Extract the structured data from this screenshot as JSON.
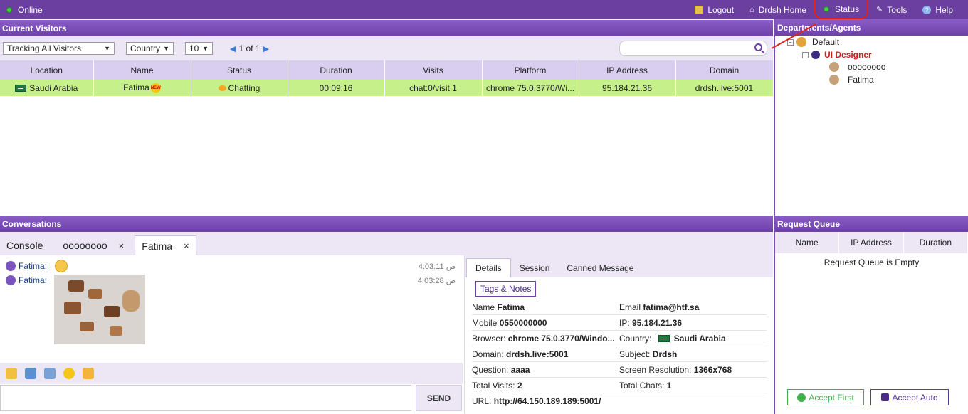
{
  "topbar": {
    "online_label": "Online",
    "nav": [
      {
        "label": "Logout",
        "icon": "logout-icon"
      },
      {
        "label": "Drdsh Home",
        "icon": "home-icon"
      },
      {
        "label": "Status",
        "icon": "status-dot-icon"
      },
      {
        "label": "Tools",
        "icon": "wrench-icon"
      },
      {
        "label": "Help",
        "icon": "help-icon"
      }
    ]
  },
  "visitors": {
    "header": "Current Visitors",
    "tracking_select": "Tracking All Visitors",
    "country_select": "Country",
    "per_page_select": "10",
    "pager_text": "1 of 1",
    "columns": [
      "Location",
      "Name",
      "Status",
      "Duration",
      "Visits",
      "Platform",
      "IP Address",
      "Domain"
    ],
    "rows": [
      {
        "location": "Saudi Arabia",
        "name": "Fatima",
        "new_badge": "NEW",
        "status": "Chatting",
        "duration": "00:09:16",
        "visits": "chat:0/visit:1",
        "platform": "chrome 75.0.3770/Wi...",
        "ip": "95.184.21.36",
        "domain": "drdsh.live:5001"
      }
    ]
  },
  "departments": {
    "header": "Departments/Agents",
    "default_label": "Default",
    "group_label": "UI Designer",
    "agents": [
      "oooooooo",
      "Fatima"
    ]
  },
  "conversations": {
    "header": "Conversations",
    "tabs": [
      {
        "label": "Console"
      },
      {
        "label": "oooooooo",
        "close": "×"
      },
      {
        "label": "Fatima",
        "close": "×"
      }
    ],
    "messages": [
      {
        "sender": "Fatima:",
        "time": "4:03:11 ص"
      },
      {
        "sender": "Fatima:",
        "time": "4:03:28 ص"
      }
    ],
    "send_label": "SEND"
  },
  "details": {
    "tabs": [
      "Details",
      "Session",
      "Canned Message"
    ],
    "tags_button": "Tags & Notes",
    "fields": [
      {
        "l1": "Name",
        "v1": "Fatima",
        "l2": "Email",
        "v2": "fatima@htf.sa"
      },
      {
        "l1": "Mobile",
        "v1": "0550000000",
        "l2": "IP:",
        "v2": "95.184.21.36"
      },
      {
        "l1": "Browser:",
        "v1": "chrome 75.0.3770/Windo...",
        "l2": "Country:",
        "v2": "Saudi Arabia"
      },
      {
        "l1": "Domain:",
        "v1": "drdsh.live:5001",
        "l2": "Subject:",
        "v2": "Drdsh"
      },
      {
        "l1": "Question:",
        "v1": "aaaa",
        "l2": "Screen Resolution:",
        "v2": "1366x768"
      },
      {
        "l1": "Total Visits:",
        "v1": "2",
        "l2": "Total Chats:",
        "v2": "1"
      },
      {
        "l1": "URL:",
        "v1": "http://64.150.189.189:5001/",
        "l2": "",
        "v2": ""
      }
    ]
  },
  "queue": {
    "header": "Request Queue",
    "columns": [
      "Name",
      "IP Address",
      "Duration"
    ],
    "empty_text": "Request Queue is Empty",
    "accept_first": "Accept First",
    "accept_auto": "Accept Auto"
  },
  "colors": {
    "brand": "#6a3fa0",
    "row_highlight": "#c6f08a",
    "annotation_red": "#e0241b"
  }
}
